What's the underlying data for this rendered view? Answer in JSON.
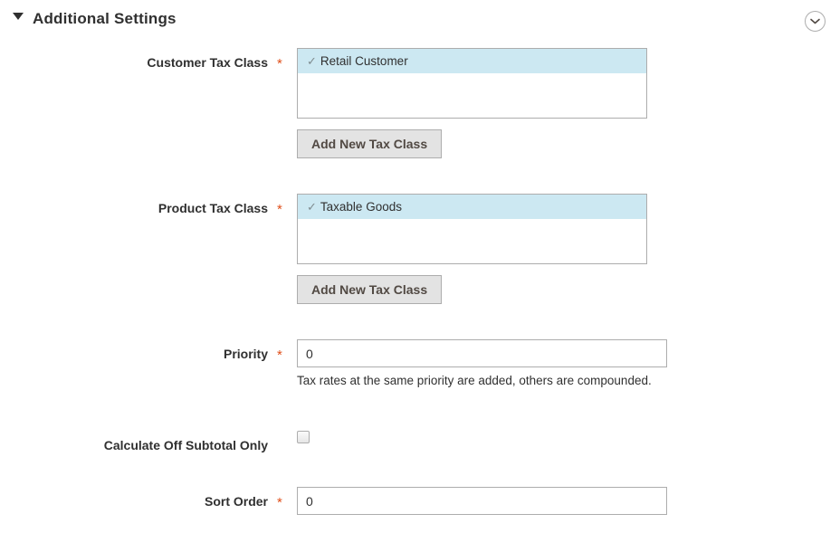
{
  "section": {
    "title": "Additional Settings",
    "caret_icon": "triangle-down-icon",
    "collapse_icon": "chevron-down-circle-icon",
    "collapse_title": "Collapse section"
  },
  "colors": {
    "required_star": "#e04f1a",
    "selected_option_bg": "#cce8f2",
    "button_bg": "#e3e3e3",
    "border": "#adadad",
    "text": "#303030"
  },
  "fields": {
    "customer_tax_class": {
      "label": "Customer Tax Class",
      "required": true,
      "required_marker": "*",
      "options": [
        {
          "label": "Retail Customer",
          "selected": true,
          "check_glyph": "✓"
        }
      ],
      "add_button_label": "Add New Tax Class"
    },
    "product_tax_class": {
      "label": "Product Tax Class",
      "required": true,
      "required_marker": "*",
      "options": [
        {
          "label": "Taxable Goods",
          "selected": true,
          "check_glyph": "✓"
        }
      ],
      "add_button_label": "Add New Tax Class"
    },
    "priority": {
      "label": "Priority",
      "required": true,
      "required_marker": "*",
      "value": "0",
      "placeholder": "",
      "note": "Tax rates at the same priority are added, others are compounded."
    },
    "calculate_off_subtotal_only": {
      "label": "Calculate Off Subtotal Only",
      "required": false,
      "checked": false
    },
    "sort_order": {
      "label": "Sort Order",
      "required": true,
      "required_marker": "*",
      "value": "0",
      "placeholder": ""
    }
  }
}
